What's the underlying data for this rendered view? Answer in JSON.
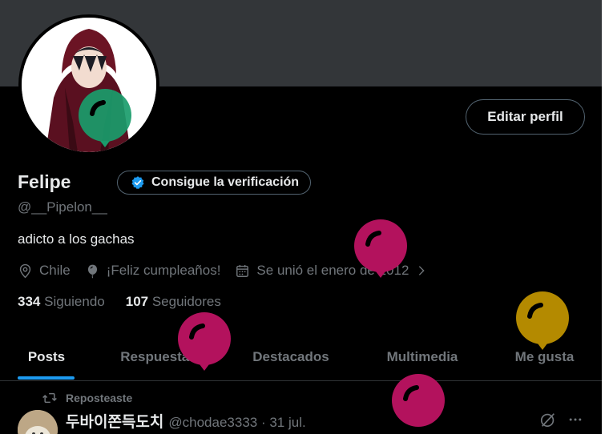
{
  "profile": {
    "name": "Felipe",
    "verify_label": "Consigue la verificación",
    "handle": "@__Pipelon__",
    "bio": "adicto a los gachas",
    "edit_label": "Editar perfil",
    "location": "Chile",
    "birthday": "¡Feliz cumpleaños!",
    "joined": "Se unió el enero de 2012",
    "following_count": "334",
    "following_label": "Siguiendo",
    "followers_count": "107",
    "followers_label": "Seguidores"
  },
  "tabs": [
    {
      "label": "Posts"
    },
    {
      "label": "Respuestas"
    },
    {
      "label": "Destacados"
    },
    {
      "label": "Multimedia"
    },
    {
      "label": "Me gusta"
    }
  ],
  "post": {
    "repost_label": "Reposteaste",
    "author": "두바이쫀득도치",
    "meta": "@chodae3333 · 31 jul."
  },
  "colors": {
    "accent": "#1d9bf0",
    "balloon_green": "#1a9c6b",
    "balloon_magenta": "#b3125d",
    "balloon_gold": "#b48a00"
  }
}
